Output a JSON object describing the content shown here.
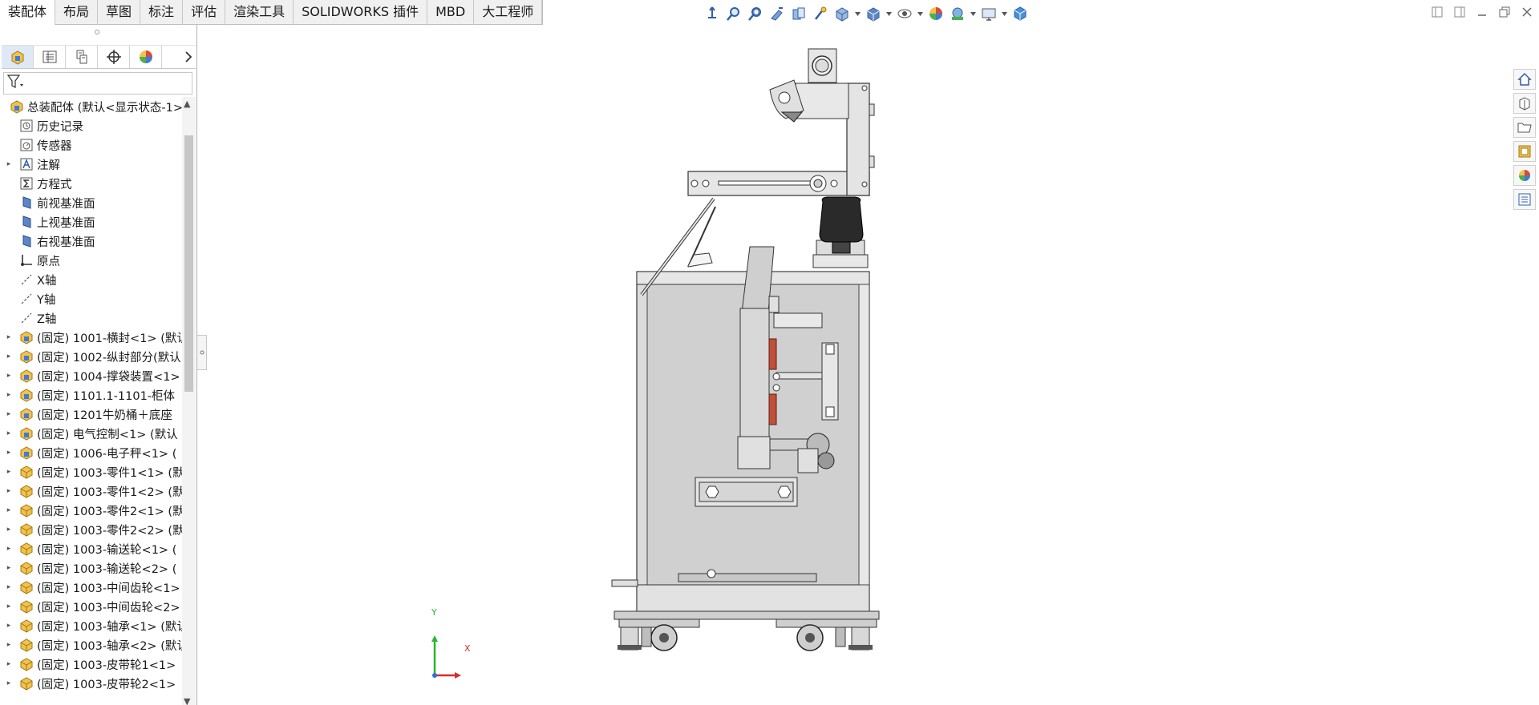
{
  "command_manager": {
    "tabs": [
      "装配体",
      "布局",
      "草图",
      "标注",
      "评估",
      "渲染工具",
      "SOLIDWORKS 插件",
      "MBD",
      "大工程师"
    ],
    "active_tab": "装配体"
  },
  "heads_up_toolbar": {
    "icons": [
      "view-orientation-icon",
      "zoom-to-fit-icon",
      "zoom-to-area-icon",
      "previous-view-icon",
      "section-view-icon",
      "dynamic-annotation-icon",
      "view-orientation-cube-icon",
      "display-style-icon",
      "hide-show-items-icon",
      "edit-appearance-icon",
      "apply-scene-icon",
      "view-settings-icon",
      "3d-view-icon"
    ]
  },
  "window_controls": [
    "tile-left-icon",
    "tile-right-icon",
    "minimize-icon",
    "restore-icon",
    "close-icon"
  ],
  "feature_manager": {
    "panel_tabs": [
      "feature-manager-icon",
      "property-manager-icon",
      "configuration-manager-icon",
      "dimxpert-icon",
      "display-manager-icon"
    ],
    "tree": [
      {
        "label": "总装配体  (默认<显示状态-1>",
        "icon": "assembly",
        "indent": 0,
        "exp": ""
      },
      {
        "label": "历史记录",
        "icon": "history",
        "indent": 1,
        "exp": ""
      },
      {
        "label": "传感器",
        "icon": "sensor",
        "indent": 1,
        "exp": ""
      },
      {
        "label": "注解",
        "icon": "annotation",
        "indent": 1,
        "exp": "▸"
      },
      {
        "label": "方程式",
        "icon": "equation",
        "indent": 1,
        "exp": ""
      },
      {
        "label": "前视基准面",
        "icon": "plane",
        "indent": 1,
        "exp": ""
      },
      {
        "label": "上视基准面",
        "icon": "plane",
        "indent": 1,
        "exp": ""
      },
      {
        "label": "右视基准面",
        "icon": "plane",
        "indent": 1,
        "exp": ""
      },
      {
        "label": "原点",
        "icon": "origin",
        "indent": 1,
        "exp": ""
      },
      {
        "label": "X轴",
        "icon": "axis",
        "indent": 1,
        "exp": ""
      },
      {
        "label": "Y轴",
        "icon": "axis",
        "indent": 1,
        "exp": ""
      },
      {
        "label": "Z轴",
        "icon": "axis",
        "indent": 1,
        "exp": ""
      },
      {
        "label": "(固定) 1001-横封<1> (默认",
        "icon": "subassembly",
        "indent": 1,
        "exp": "▸"
      },
      {
        "label": "(固定) 1002-纵封部分(默认",
        "icon": "subassembly",
        "indent": 1,
        "exp": "▸"
      },
      {
        "label": "(固定) 1004-撑袋装置<1>",
        "icon": "subassembly",
        "indent": 1,
        "exp": "▸"
      },
      {
        "label": "(固定) 1101.1-1101-柜体",
        "icon": "subassembly",
        "indent": 1,
        "exp": "▸"
      },
      {
        "label": "(固定) 1201牛奶桶＋底座",
        "icon": "subassembly",
        "indent": 1,
        "exp": "▸"
      },
      {
        "label": "(固定) 电气控制<1> (默认",
        "icon": "subassembly",
        "indent": 1,
        "exp": "▸"
      },
      {
        "label": "(固定) 1006-电子秤<1> (",
        "icon": "subassembly",
        "indent": 1,
        "exp": "▸"
      },
      {
        "label": "(固定) 1003-零件1<1> (默",
        "icon": "part",
        "indent": 1,
        "exp": "▸"
      },
      {
        "label": "(固定) 1003-零件1<2> (默",
        "icon": "part",
        "indent": 1,
        "exp": "▸"
      },
      {
        "label": "(固定) 1003-零件2<1> (默",
        "icon": "part",
        "indent": 1,
        "exp": "▸"
      },
      {
        "label": "(固定) 1003-零件2<2> (默",
        "icon": "part",
        "indent": 1,
        "exp": "▸"
      },
      {
        "label": "(固定) 1003-输送轮<1> (",
        "icon": "part",
        "indent": 1,
        "exp": "▸"
      },
      {
        "label": "(固定) 1003-输送轮<2> (",
        "icon": "part",
        "indent": 1,
        "exp": "▸"
      },
      {
        "label": "(固定) 1003-中间齿轮<1>",
        "icon": "part",
        "indent": 1,
        "exp": "▸"
      },
      {
        "label": "(固定) 1003-中间齿轮<2>",
        "icon": "part",
        "indent": 1,
        "exp": "▸"
      },
      {
        "label": "(固定) 1003-轴承<1> (默认",
        "icon": "part",
        "indent": 1,
        "exp": "▸"
      },
      {
        "label": "(固定) 1003-轴承<2> (默认",
        "icon": "part",
        "indent": 1,
        "exp": "▸"
      },
      {
        "label": "(固定) 1003-皮带轮1<1>",
        "icon": "part",
        "indent": 1,
        "exp": "▸"
      },
      {
        "label": "(固定) 1003-皮带轮2<1>",
        "icon": "part",
        "indent": 1,
        "exp": "▸"
      }
    ]
  },
  "triad": {
    "x_label": "X",
    "y_label": "Y"
  },
  "task_pane": [
    "solidworks-resources-icon",
    "design-library-icon",
    "file-explorer-icon",
    "view-palette-icon",
    "appearances-scenes-icon",
    "custom-properties-icon"
  ],
  "colors": {
    "accent": "#2a6fdb",
    "part_yellow": "#f2c14e",
    "assembly_blue": "#3d7bd9",
    "model_gray": "#d4d4d4",
    "heater_red": "#c0503a"
  }
}
